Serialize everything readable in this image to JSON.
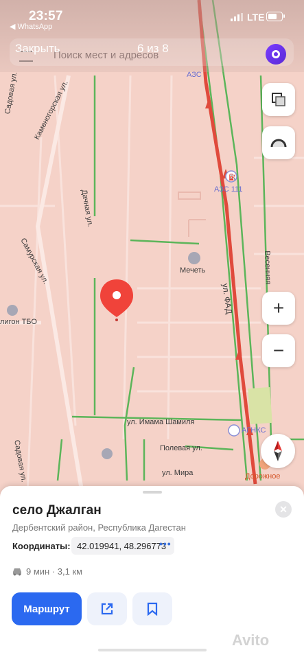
{
  "status": {
    "time": "23:57",
    "back_app": "◀ WhatsApp",
    "network": "LTE"
  },
  "topbar": {
    "close_label": "Закрыть",
    "counter": "6 из 8",
    "search_placeholder": "Поиск мест и адресов"
  },
  "map": {
    "labels": {
      "azs_top": "АЗС",
      "sadovaya_top": "Садовая ул.",
      "kamenogorskaya": "Каменогорская ул.",
      "dachnaya": "Дачная ул.",
      "samurskaya": "Самурская ул.",
      "azs111": "АЗС 111",
      "mosque": "Мечеть",
      "fad": "ул. ФАД",
      "vesennyaya": "Весенняя",
      "poligon": "лигон ТБО",
      "imama": "ул. Имама Шамиля",
      "agnks": "АГНКС",
      "sadovaya_bottom": "Садовая ул.",
      "polevaya": "Полевая ул.",
      "mira": "ул. Мира",
      "dorozhnoe": "Дорожное"
    },
    "controls": {
      "zoom_in": "+",
      "zoom_out": "−"
    }
  },
  "place": {
    "title": "село Джалган",
    "subtitle": "Дербентский район, Республика Дагестан",
    "coords_label": "Координаты:",
    "coords_value": "42.019941, 48.296773",
    "coords_more": "•••",
    "route_time": "9 мин · 3,1 км",
    "route_button": "Маршрут"
  },
  "watermark": "Avito",
  "colors": {
    "accent": "#2b69f0",
    "pin": "#f0433a",
    "road_traffic": "#e04a3c",
    "road_green": "#5cb55a"
  }
}
